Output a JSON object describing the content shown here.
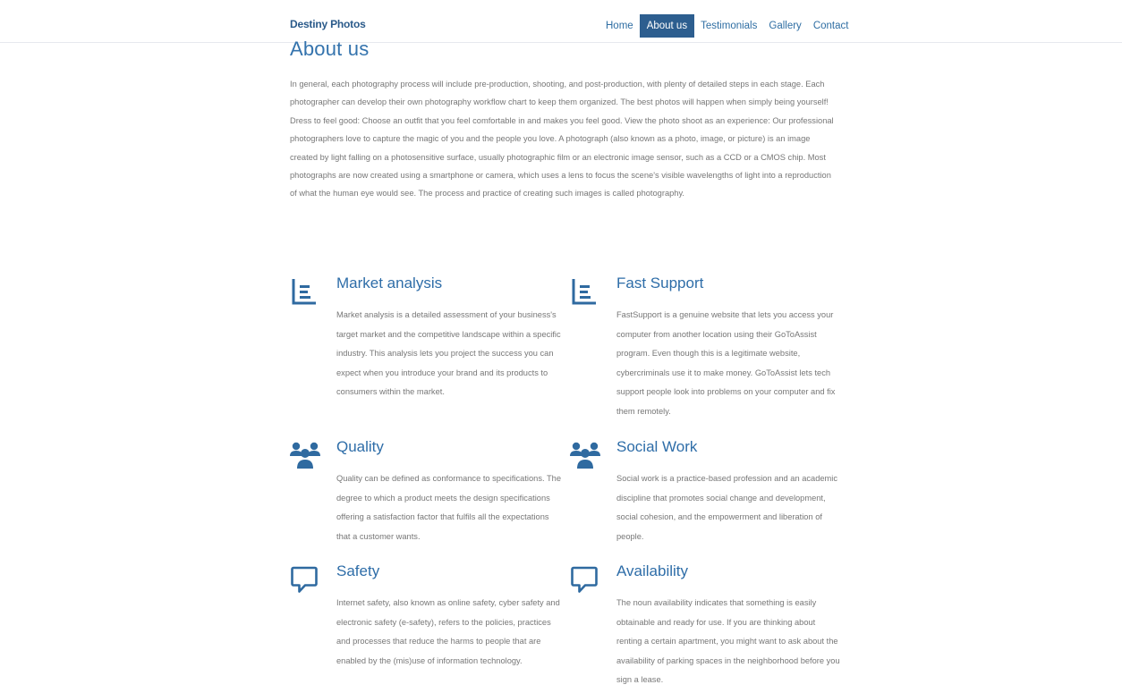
{
  "header": {
    "brand": "Destiny Photos",
    "nav": [
      "Home",
      "About us",
      "Testimonials",
      "Gallery",
      "Contact"
    ],
    "active_nav": "About us"
  },
  "about": {
    "title": "About us",
    "intro": "In general, each photography process will include pre-production, shooting, and post-production, with plenty of detailed steps in each stage. Each photographer can develop their own photography workflow chart to keep them organized. The best photos will happen when simply being yourself! Dress to feel good: Choose an outfit that you feel comfortable in and makes you feel good. View the photo shoot as an experience: Our professional photographers love to capture the magic of you and the people you love. A photograph (also known as a photo, image, or picture) is an image created by light falling on a photosensitive surface, usually photographic film or an electronic image sensor, such as a CCD or a CMOS chip. Most photographs are now created using a smartphone or camera, which uses a lens to focus the scene's visible wavelengths of light into a reproduction of what the human eye would see. The process and practice of creating such images is called photography."
  },
  "features": [
    {
      "icon": "list-icon",
      "title": "Market analysis",
      "text": "Market analysis is a detailed assessment of your business's target market and the competitive landscape within a specific industry. This analysis lets you project the success you can expect when you introduce your brand and its products to consumers within the market."
    },
    {
      "icon": "list-icon",
      "title": "Fast Support",
      "text": "FastSupport is a genuine website that lets you access your computer from another location using their GoToAssist program. Even though this is a legitimate website, cybercriminals use it to make money. GoToAssist lets tech support people look into problems on your computer and fix them remotely."
    },
    {
      "icon": "users-icon",
      "title": "Quality",
      "text": "Quality can be defined as conformance to specifications. The degree to which a product meets the design specifications offering a satisfaction factor that fulfils all the expectations that a customer wants."
    },
    {
      "icon": "users-icon",
      "title": "Social Work",
      "text": "Social work is a practice-based profession and an academic discipline that promotes social change and development, social cohesion, and the empowerment and liberation of people."
    },
    {
      "icon": "chat-bubble-icon",
      "title": "Safety",
      "text": "Internet safety, also known as online safety, cyber safety and electronic safety (e-safety), refers to the policies, practices and processes that reduce the harms to people that are enabled by the (mis)use of information technology."
    },
    {
      "icon": "chat-bubble-icon",
      "title": "Availability",
      "text": "The noun availability indicates that something is easily obtainable and ready for use. If you are thinking about renting a certain apartment, you might want to ask about the availability of parking spaces in the neighborhood before you sign a lease."
    }
  ],
  "colors": {
    "accent": "#2d5e8f",
    "heading": "#3473ad",
    "icon": "#2f6aa0",
    "body_text": "#777777"
  }
}
